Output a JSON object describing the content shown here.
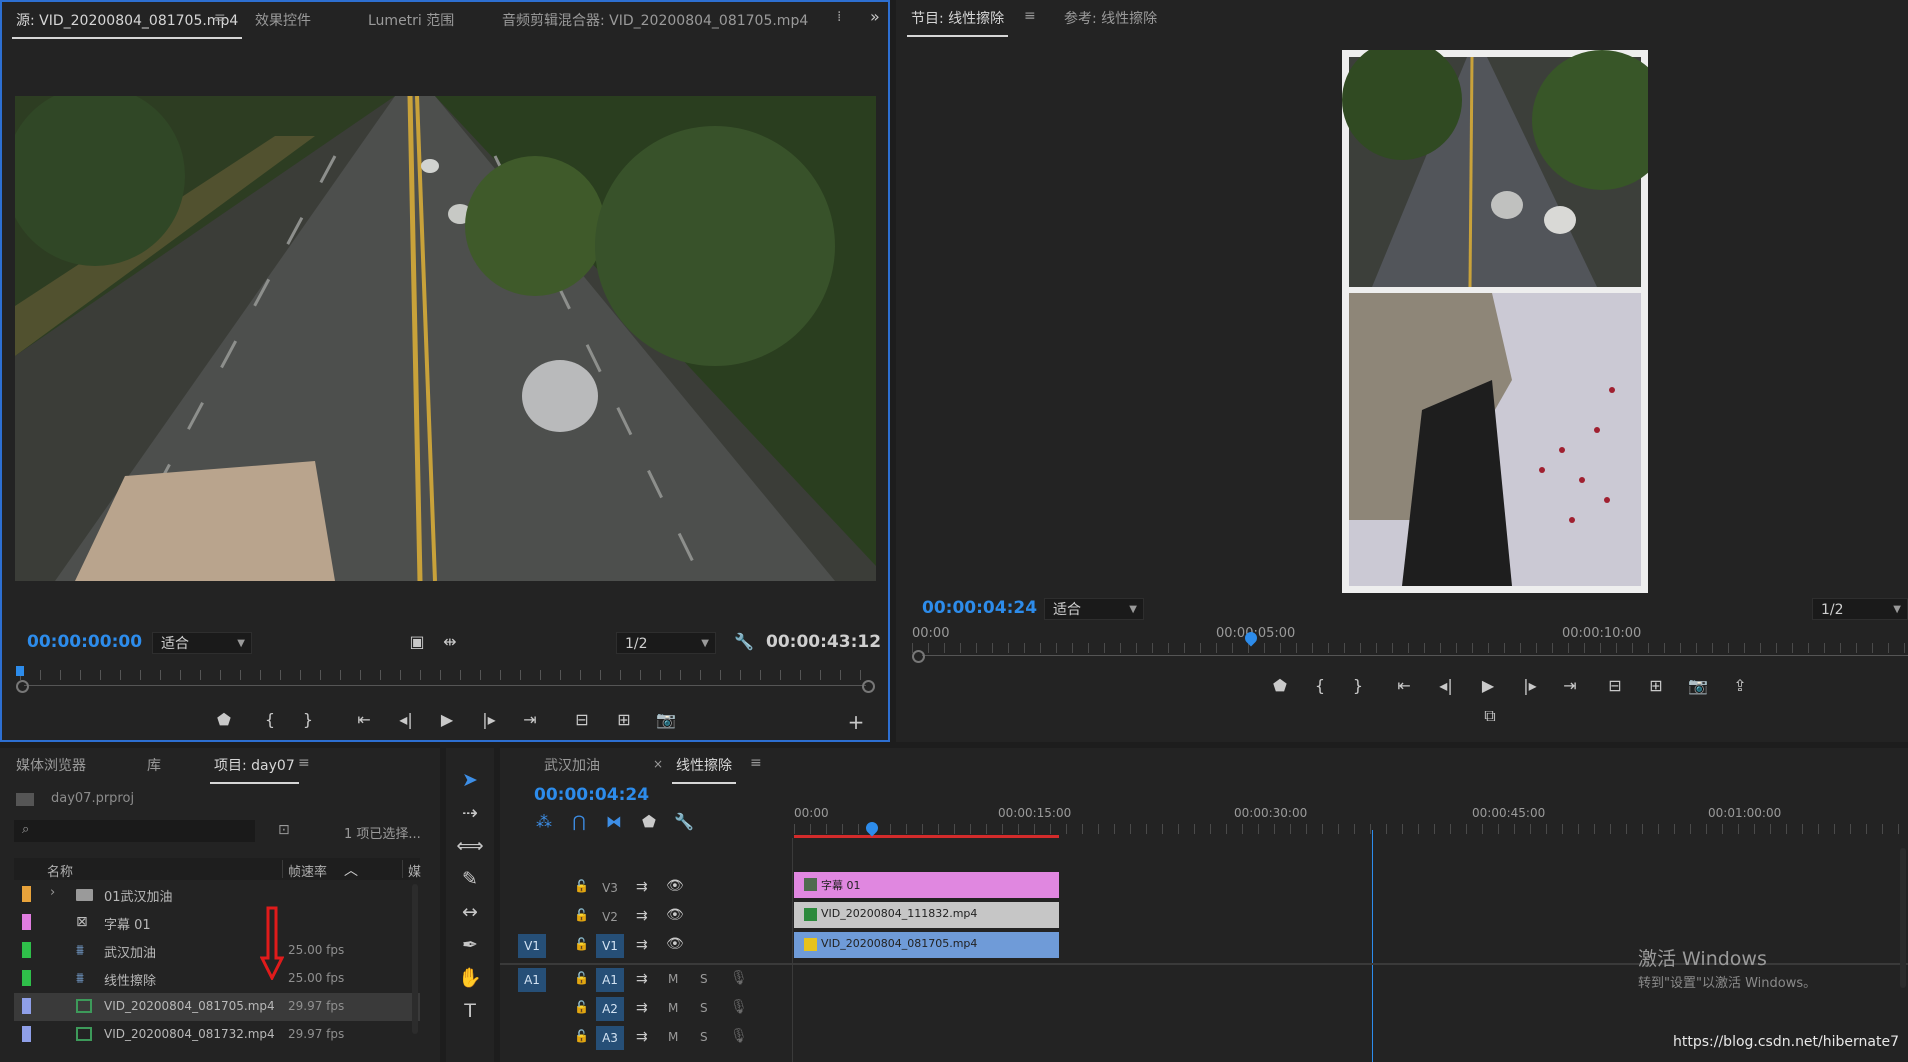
{
  "source_monitor": {
    "tabs": [
      "源: VID_20200804_081705.mp4",
      "效果控件",
      "Lumetri 范围",
      "音频剪辑混合器: VID_20200804_081705.mp4"
    ],
    "timecode_current": "00:00:00:00",
    "zoom": "适合",
    "resolution": "1/2",
    "timecode_duration": "00:00:43:12"
  },
  "program_monitor": {
    "tabs": [
      "节目: 线性擦除",
      "参考: 线性擦除"
    ],
    "timecode_current": "00:00:04:24",
    "zoom": "适合",
    "resolution": "1/2",
    "ruler": [
      "00:00",
      "00:00:05:00",
      "00:00:10:00"
    ],
    "playhead_fraction": 0.34
  },
  "project_panel": {
    "tabs": [
      "媒体浏览器",
      "库",
      "项目: day07"
    ],
    "project_file": "day07.prproj",
    "selection_info": "1 项已选择...",
    "columns": {
      "name": "名称",
      "fps": "帧速率",
      "media": "媒"
    },
    "items": [
      {
        "name": "01武汉加油",
        "fps": "",
        "color": "#e8a33b",
        "icon": "folder-icon",
        "selected": false
      },
      {
        "name": "字幕 01",
        "fps": "",
        "color": "#e07de0",
        "icon": "title-icon",
        "selected": false
      },
      {
        "name": "武汉加油",
        "fps": "25.00 fps",
        "color": "#2fbf4a",
        "icon": "sequence-icon",
        "selected": false
      },
      {
        "name": "线性擦除",
        "fps": "25.00 fps",
        "color": "#2fbf4a",
        "icon": "sequence-icon",
        "selected": false
      },
      {
        "name": "VID_20200804_081705.mp4",
        "fps": "29.97 fps",
        "color": "#8f9fe8",
        "icon": "video-clip-icon",
        "selected": true
      },
      {
        "name": "VID_20200804_081732.mp4",
        "fps": "29.97 fps",
        "color": "#8f9fe8",
        "icon": "video-clip-icon",
        "selected": false
      }
    ]
  },
  "timeline": {
    "tabs": [
      "武汉加油",
      "线性擦除"
    ],
    "timecode": "00:00:04:24",
    "ruler": [
      "00:00",
      "00:00:15:00",
      "00:00:30:00",
      "00:00:45:00",
      "00:01:00:00"
    ],
    "tracks": [
      {
        "id": "V3",
        "source": "",
        "kind": "video"
      },
      {
        "id": "V2",
        "source": "",
        "kind": "video"
      },
      {
        "id": "V1",
        "source": "V1",
        "kind": "video"
      },
      {
        "id": "A1",
        "source": "A1",
        "kind": "audio"
      },
      {
        "id": "A2",
        "source": "",
        "kind": "audio"
      },
      {
        "id": "A3",
        "source": "",
        "kind": "audio"
      }
    ],
    "audio_m": "M",
    "audio_s": "S",
    "clips": [
      {
        "track": "V3",
        "name": "字幕 01",
        "color": "#e087e0"
      },
      {
        "track": "V2",
        "name": "VID_20200804_111832.mp4",
        "color": "#c6c6c6"
      },
      {
        "track": "V1",
        "name": "VID_20200804_081705.mp4",
        "color": "#6f9bd8"
      }
    ]
  },
  "watermark": {
    "line1": "激活 Windows",
    "line2": "转到\"设置\"以激活 Windows。",
    "url": "https://blog.csdn.net/hibernate7"
  }
}
